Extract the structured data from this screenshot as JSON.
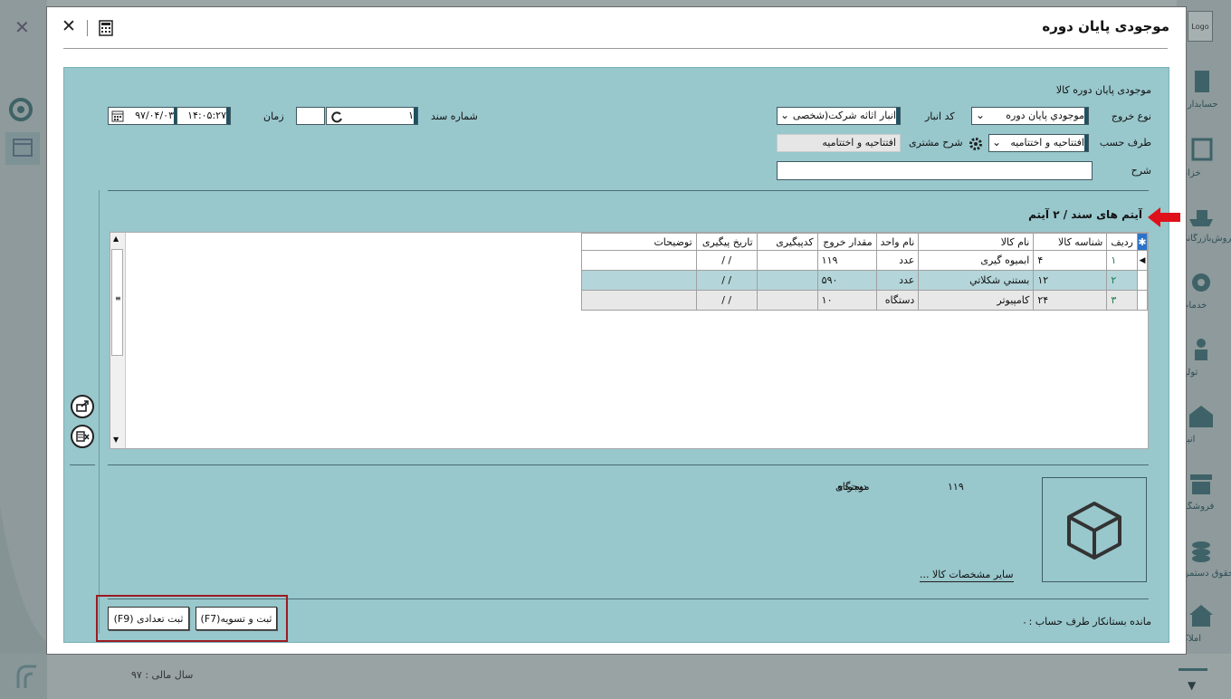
{
  "background": {
    "close_glyph": "✕",
    "logo_text": "Logo",
    "fiscal_year": "سال مالی : ۹۷",
    "side_items": [
      "حسابداری",
      "خزانه",
      "فروش‌بازرگانی",
      "خدمات",
      "تولید",
      "انبار",
      "فروشگاه",
      "حقوق دستمزد",
      "املاک"
    ]
  },
  "dialog": {
    "title": "موجودی پایان دوره",
    "close_glyph": "✕",
    "section_title": "موجودی پایان دوره کالا",
    "header": {
      "date_value": "۹۷/۰۴/۰۳",
      "time_value": "۱۴:۰۵:۲۷",
      "time_label": "زمان",
      "doc_no_label": "شماره سند",
      "doc_no_value": "۱",
      "exit_type_label": "نوع خروج",
      "exit_type_value": "موجودي پايان دوره",
      "warehouse_code_label": "کد انبار",
      "warehouse_value": "انبار اثاثه شرکت(شخصی",
      "account_side_label": "طرف حسب",
      "account_side_value": "افتتاحیه و اختتامیه",
      "customer_desc_label": "شرح مشتری",
      "customer_desc_value": "افتتاحیه و اختتامیه",
      "desc_label": "شرح",
      "desc_value": ""
    },
    "items_title": "آیتم های سند / ۲ آیتم",
    "grid": {
      "columns": [
        "ردیف",
        "شناسه کالا",
        "نام کالا",
        "نام واحد",
        "مقدار خروج",
        "کدپیگیری",
        "تاریخ پیگیری",
        "توضیحات"
      ],
      "rows": [
        {
          "row": "۱",
          "id": "۴",
          "name": "ابمیوه گیری",
          "unit": "عدد",
          "qty": "۱۱۹",
          "tracking": "",
          "date": "/  /",
          "notes": ""
        },
        {
          "row": "۲",
          "id": "۱۲",
          "name": "بستني شکلاتي",
          "unit": "عدد",
          "qty": "۵۹۰",
          "tracking": "",
          "date": "/  /",
          "notes": ""
        },
        {
          "row": "۳",
          "id": "۲۴",
          "name": "کامپیوتر",
          "unit": "دستگاه",
          "qty": "۱۰",
          "tracking": "",
          "date": "/  /",
          "notes": ""
        }
      ]
    },
    "info": {
      "stock_label": "موجودی",
      "stock_value": "۱۱۹",
      "stock_unit": "دستگاه",
      "other_specs_link": "سایر مشخصات کالا ..."
    },
    "footer": {
      "balance_label": "مانده بستانکار طرف حساب :",
      "balance_value": "۰",
      "btn_settle": "ثبت و تسویه(F7)",
      "btn_count": "ثبت تعدادی (F9)"
    }
  },
  "colors": {
    "panel": "#98c7cc",
    "highlight_red": "#c0202a",
    "arrow_red": "#e0101a",
    "row_selected": "#b4d5d9",
    "grid_header_star": "#2a73c8"
  }
}
